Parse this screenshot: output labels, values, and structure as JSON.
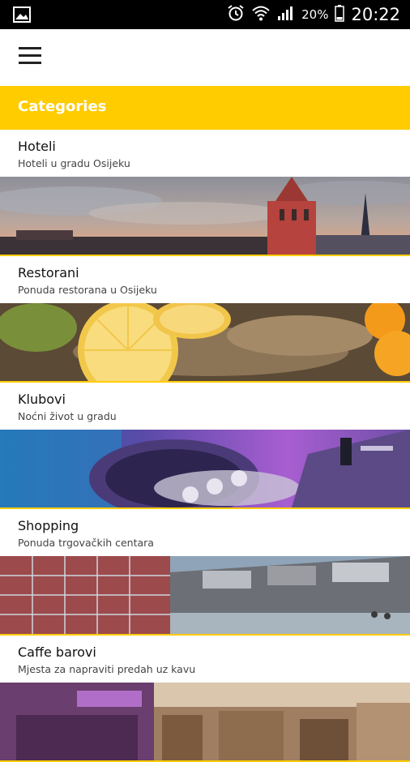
{
  "status_bar": {
    "time": "20:22",
    "battery_percent": "20%",
    "icons": [
      "gallery-notification-icon",
      "alarm-icon",
      "wifi-icon",
      "signal-icon",
      "battery-icon"
    ]
  },
  "app_bar": {
    "menu_icon": "hamburger-menu-icon"
  },
  "header": {
    "title": "Categories",
    "accent_color": "#FFCC00"
  },
  "categories": [
    {
      "title": "Hoteli",
      "subtitle": "Hoteli u gradu Osijeku",
      "image": "city-church-skyline"
    },
    {
      "title": "Restorani",
      "subtitle": "Ponuda restorana u Osijeku",
      "image": "fried-fish-with-lemon"
    },
    {
      "title": "Klubovi",
      "subtitle": "Noćni život u gradu",
      "image": "dj-turntable"
    },
    {
      "title": "Shopping",
      "subtitle": "Ponuda trgovačkih centara",
      "image": "shopping-center-facade"
    },
    {
      "title": "Caffe barovi",
      "subtitle": "Mjesta za napraviti predah uz kavu",
      "image": "cafe-interior"
    }
  ]
}
